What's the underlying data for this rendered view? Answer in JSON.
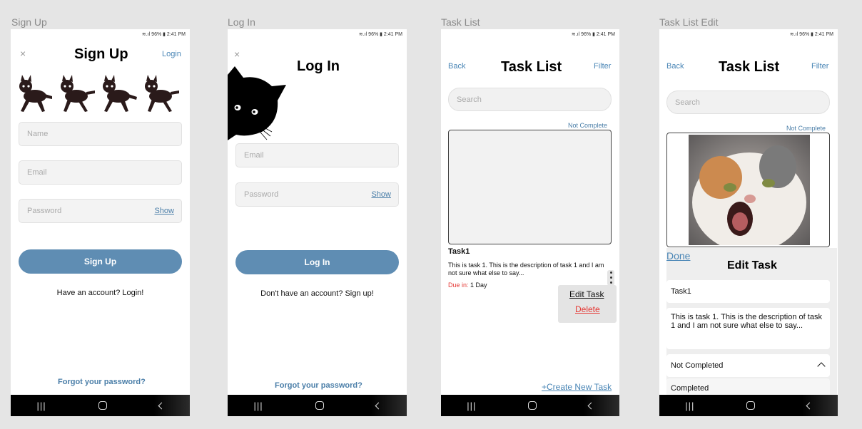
{
  "status_bar": "≋.ıl 96% ▮ 2:41 PM",
  "nav_icons": [
    "recents-icon",
    "home-icon",
    "back-icon"
  ],
  "colors": {
    "accent": "#4a86b6",
    "button": "#5f8db3",
    "danger": "#e53935"
  },
  "signup": {
    "frame_label": "Sign Up",
    "close": "×",
    "title": "Sign Up",
    "login_link": "Login",
    "name_placeholder": "Name",
    "email_placeholder": "Email",
    "password_placeholder": "Password",
    "show": "Show",
    "button": "Sign Up",
    "have_account": "Have an account? Login!",
    "forgot": "Forgot your password?"
  },
  "login": {
    "frame_label": "Log In",
    "close": "×",
    "title": "Log In",
    "email_placeholder": "Email",
    "password_placeholder": "Password",
    "show": "Show",
    "button": "Log In",
    "no_account": "Don't have an account? Sign up!",
    "forgot": "Forgot your password?"
  },
  "tasklist": {
    "frame_label": "Task List",
    "back": "Back",
    "title": "Task List",
    "filter": "Filter",
    "search_placeholder": "Search",
    "status": "Not Complete",
    "task_name": "Task1",
    "task_desc": "This is task 1. This is the description of task 1 and I am not sure what else to say...",
    "due_label": "Due in:",
    "due_value": "1 Day",
    "edit": "Edit Task",
    "delete": "Delete",
    "create": "+Create New Task"
  },
  "tasklist_edit": {
    "frame_label": "Task List Edit",
    "back": "Back",
    "title": "Task List",
    "filter": "Filter",
    "search_placeholder": "Search",
    "status": "Not Complete",
    "done": "Done",
    "sheet_title": "Edit Task",
    "name_value": "Task1",
    "desc_value": "This is task 1. This is the description of task 1 and I am not sure what else to say...",
    "select_value": "Not Completed",
    "option_completed": "Completed"
  }
}
